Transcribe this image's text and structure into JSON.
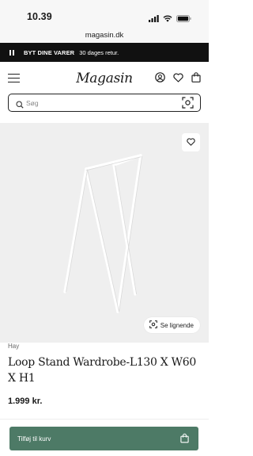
{
  "status": {
    "time": "10.39"
  },
  "browser": {
    "url": "magasin.dk"
  },
  "promo": {
    "bold_text": "BYT DINE VARER",
    "text": "30 dages retur."
  },
  "header": {
    "logo": "Magasin"
  },
  "search": {
    "placeholder": "Søg"
  },
  "gallery": {
    "similar_label": "Se lignende"
  },
  "product": {
    "brand": "Hay",
    "title": "Loop Stand Wardrobe-L130 X W60 X H1",
    "price": "1.999 kr."
  },
  "cta": {
    "add_to_cart": "Tilføj til kurv"
  },
  "colors": {
    "promo_bg": "#111111",
    "cta_green": "#4d7a66",
    "gallery_bg": "#efefef"
  }
}
